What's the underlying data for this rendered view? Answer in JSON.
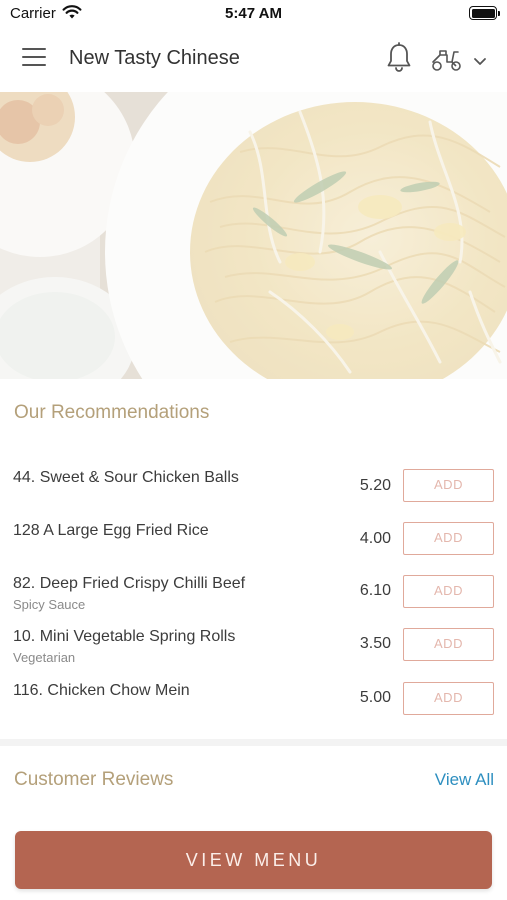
{
  "status_bar": {
    "carrier": "Carrier",
    "time": "5:47 AM",
    "icons": [
      "wifi-icon",
      "battery-icon"
    ]
  },
  "header": {
    "title": "New Tasty Chinese",
    "icons": [
      "menu-icon",
      "bell-icon",
      "scooter-icon",
      "chevron-down-icon"
    ]
  },
  "hero": {
    "image": "stir-fried noodles dish"
  },
  "recommendations": {
    "title": "Our Recommendations",
    "add_label": "ADD",
    "items": [
      {
        "name": "44. Sweet & Sour Chicken Balls",
        "subtitle": "",
        "price": "5.20"
      },
      {
        "name": "128 A Large Egg Fried Rice",
        "subtitle": "",
        "price": "4.00"
      },
      {
        "name": "82. Deep Fried Crispy Chilli Beef",
        "subtitle": "Spicy Sauce",
        "price": "6.10"
      },
      {
        "name": "10. Mini Vegetable Spring Rolls",
        "subtitle": "Vegetarian",
        "price": "3.50"
      },
      {
        "name": "116. Chicken Chow Mein",
        "subtitle": "",
        "price": "5.00"
      }
    ]
  },
  "reviews": {
    "title": "Customer Reviews",
    "view_all_label": "View All"
  },
  "footer": {
    "view_menu_label": "VIEW MENU"
  },
  "colors": {
    "accent": "#b46551",
    "section_title": "#b4a07a",
    "link": "#2e8fc0",
    "add_border": "#e0a99b"
  }
}
